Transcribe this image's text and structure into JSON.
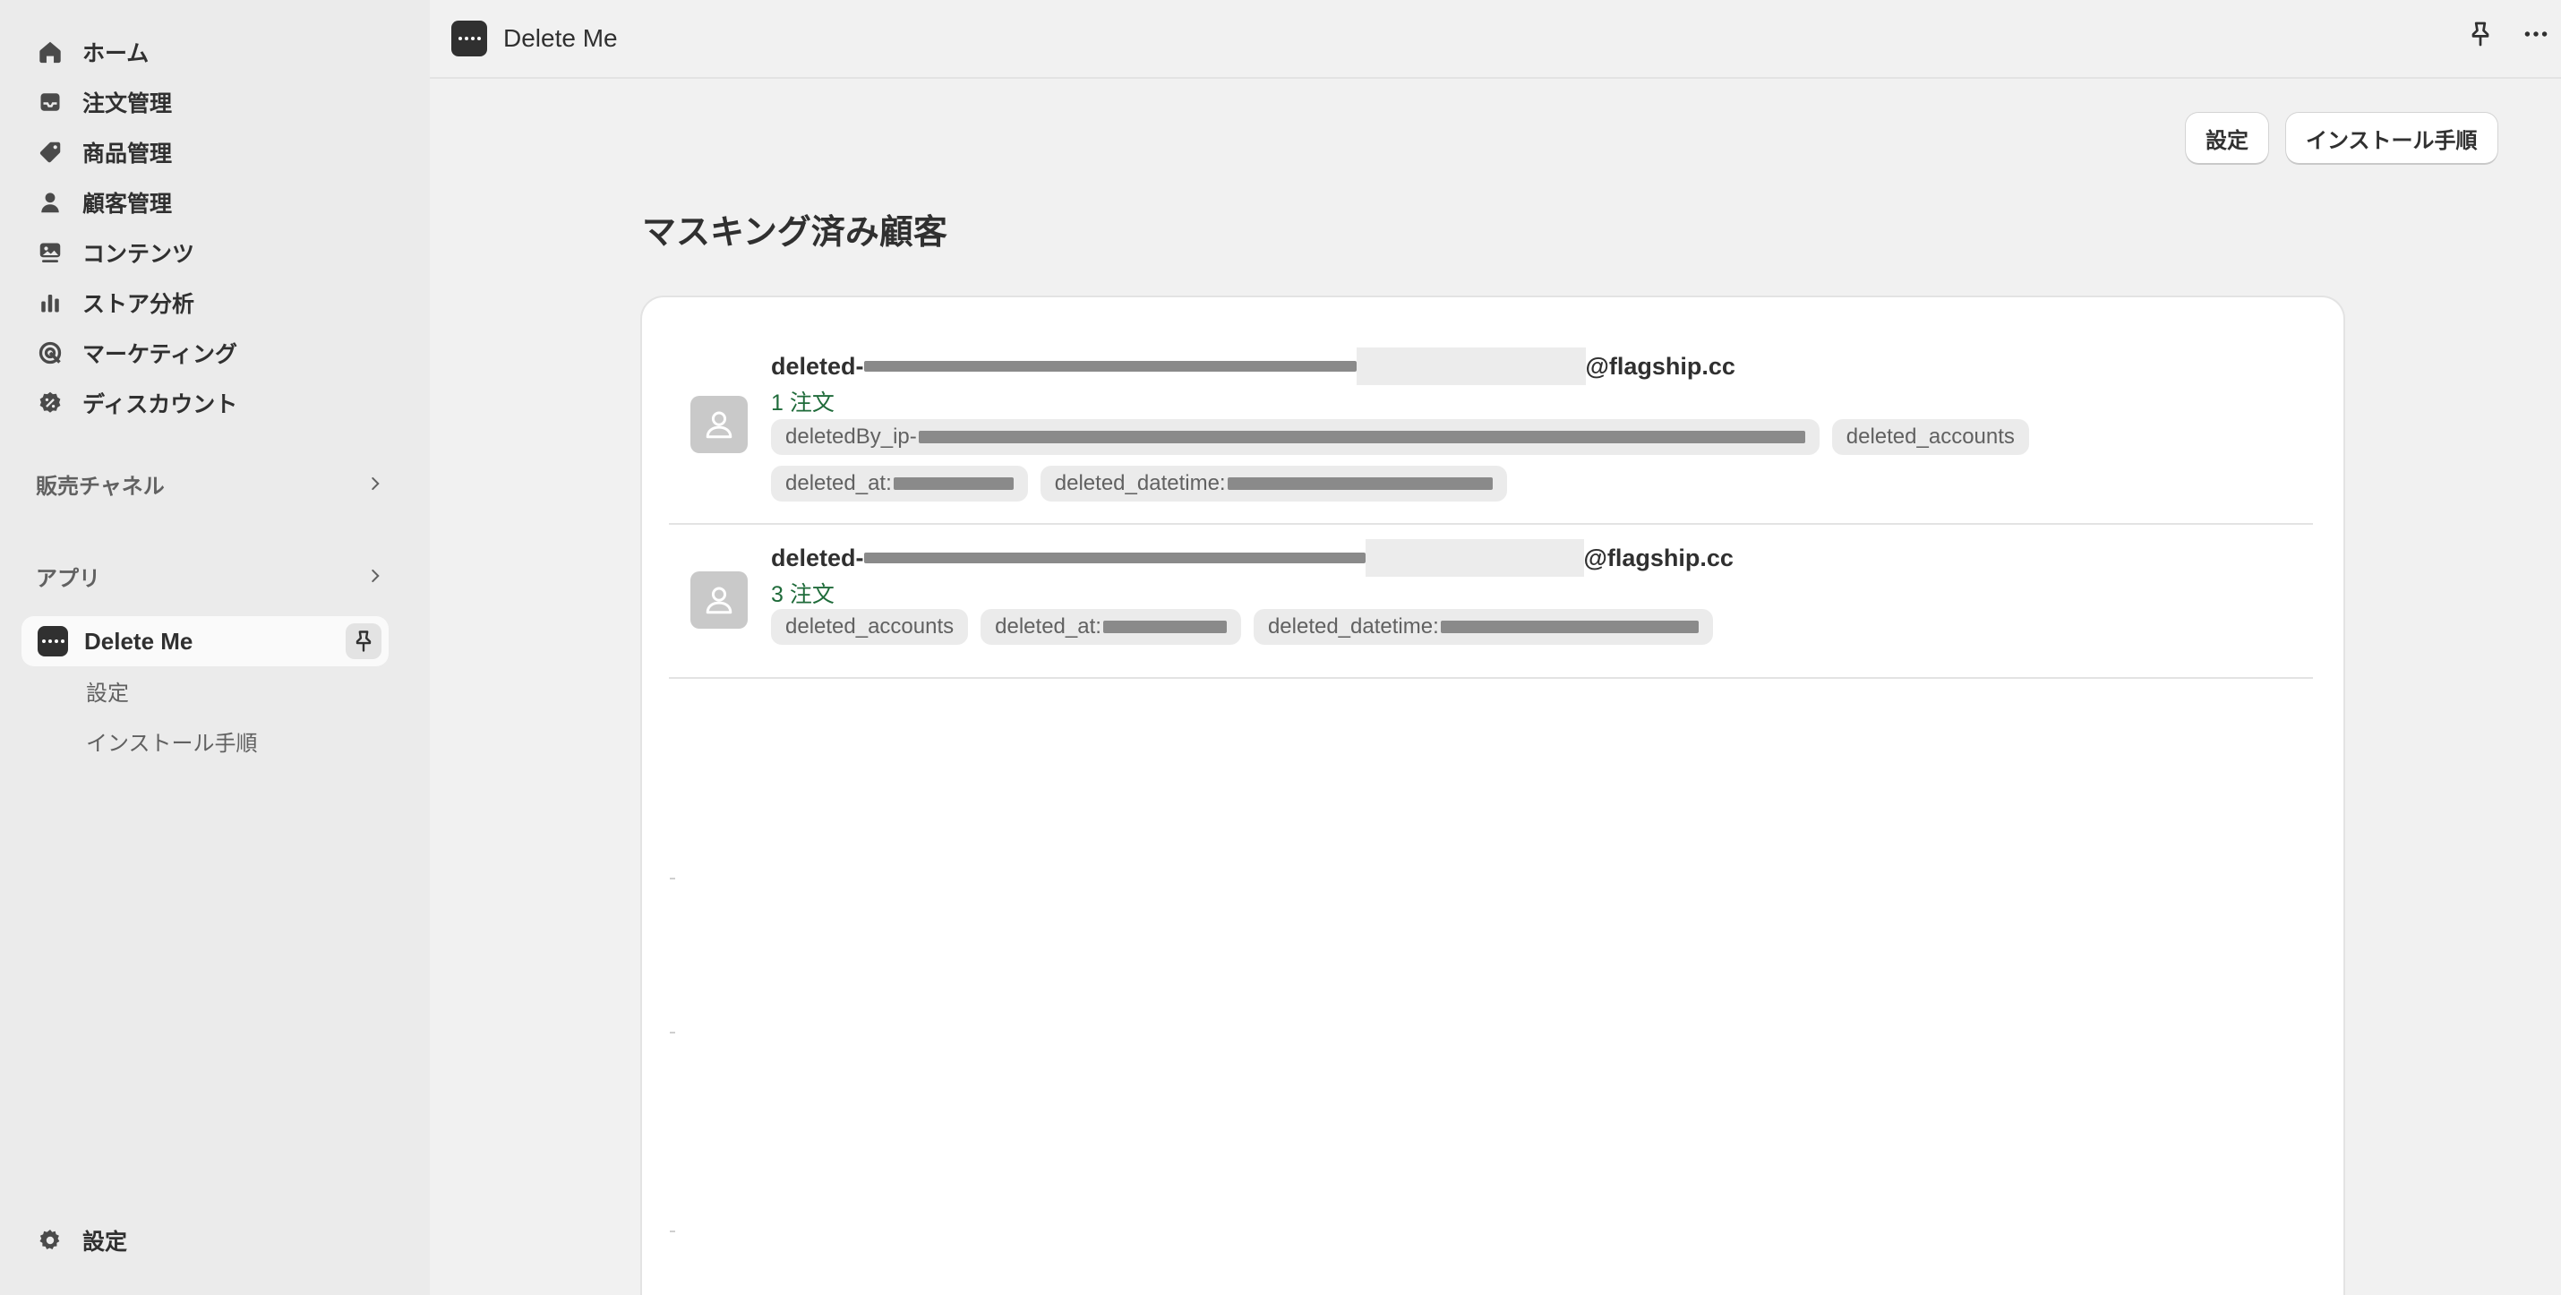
{
  "sidebar": {
    "items": [
      {
        "label": "ホーム",
        "icon": "home-icon"
      },
      {
        "label": "注文管理",
        "icon": "inbox-icon"
      },
      {
        "label": "商品管理",
        "icon": "tag-icon"
      },
      {
        "label": "顧客管理",
        "icon": "person-icon"
      },
      {
        "label": "コンテンツ",
        "icon": "image-icon"
      },
      {
        "label": "ストア分析",
        "icon": "bar-chart-icon"
      },
      {
        "label": "マーケティング",
        "icon": "target-icon"
      },
      {
        "label": "ディスカウント",
        "icon": "discount-icon"
      }
    ],
    "sales_channels": "販売チャネル",
    "apps": "アプリ",
    "active_app": "Delete Me",
    "sub_items": [
      "設定",
      "インストール手順"
    ],
    "settings": "設定"
  },
  "topbar": {
    "title": "Delete Me"
  },
  "actions": {
    "settings": "設定",
    "install": "インストール手順"
  },
  "page": {
    "title": "マスキング済み顧客"
  },
  "customers": [
    {
      "email_prefix": "deleted-",
      "email_suffix": "@flagship.cc",
      "orders": "1 注文",
      "tags": [
        "deletedBy_ip-",
        "deleted_accounts",
        "deleted_at:",
        "deleted_datetime:"
      ]
    },
    {
      "email_prefix": "deleted-",
      "email_suffix": "@flagship.cc",
      "orders": "3 注文",
      "tags": [
        "deleted_accounts",
        "deleted_at:",
        "deleted_datetime:"
      ]
    }
  ]
}
